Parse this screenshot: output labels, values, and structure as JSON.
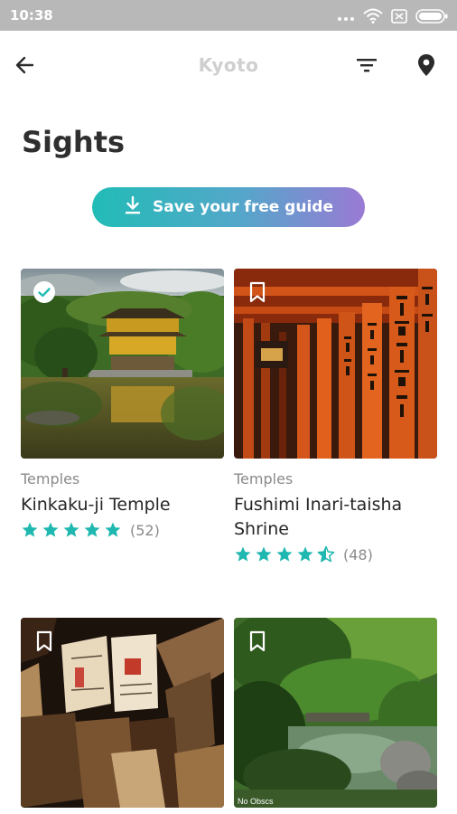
{
  "status_bar": {
    "time": "10:38",
    "icons": [
      "signal-dots-icon",
      "wifi-icon",
      "battery-saver-icon",
      "battery-icon"
    ]
  },
  "header": {
    "app_title": "Kyoto",
    "back_icon": "arrow-left-icon",
    "filter_icon": "filter-icon",
    "map_icon": "map-pin-icon"
  },
  "page": {
    "title": "Sights",
    "save_guide_label": "Save your free guide",
    "save_guide_icon": "download-icon"
  },
  "colors": {
    "accent": "#21bcb6",
    "gradient_start": "#21bcb6",
    "gradient_end": "#9a7ad4",
    "star": "#1fb8b0"
  },
  "cards": [
    {
      "category": "Temples",
      "name": "Kinkaku-ji Temple",
      "rating": 5,
      "reviews": "(52)",
      "saved": true,
      "photo": "golden-pavilion-photo"
    },
    {
      "category": "Temples",
      "name": "Fushimi Inari-taisha Shrine",
      "rating": 4.5,
      "reviews": "(48)",
      "saved": false,
      "photo": "torii-gates-photo"
    },
    {
      "category": "",
      "name": "",
      "saved": false,
      "photo": "ema-wooden-plaques-photo"
    },
    {
      "category": "",
      "name": "",
      "saved": false,
      "photo": "japanese-garden-pond-photo",
      "photo_credit": "No Obscs"
    }
  ]
}
